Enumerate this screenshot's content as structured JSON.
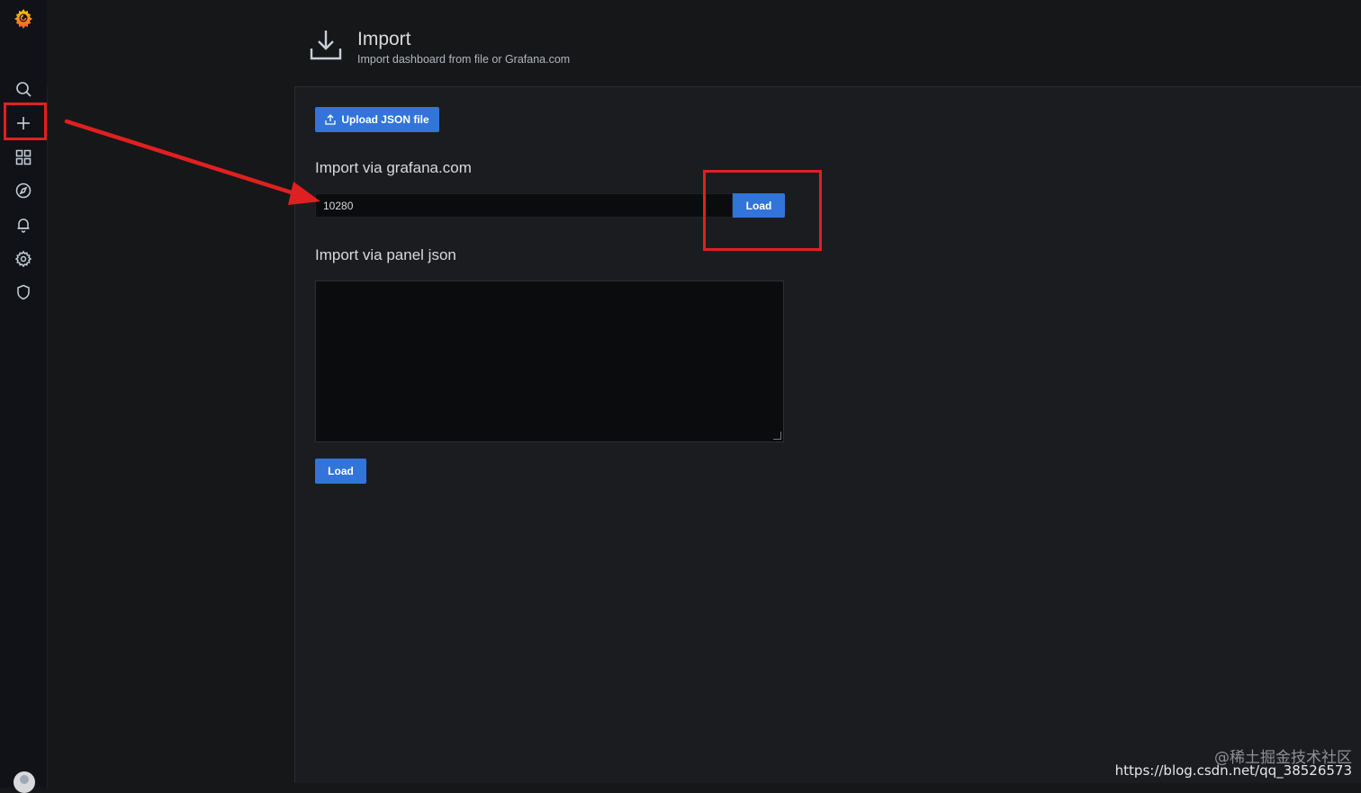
{
  "sidebar": {
    "items": [
      {
        "name": "search-icon"
      },
      {
        "name": "plus-icon"
      },
      {
        "name": "dashboards-icon"
      },
      {
        "name": "compass-icon"
      },
      {
        "name": "bell-icon"
      },
      {
        "name": "gear-icon"
      },
      {
        "name": "shield-icon"
      }
    ],
    "highlighted_item": "plus-icon"
  },
  "header": {
    "title": "Import",
    "subtitle": "Import dashboard from file or Grafana.com",
    "icon": "download-icon"
  },
  "upload": {
    "label": "Upload JSON file",
    "icon": "upload-icon"
  },
  "grafana_import": {
    "title": "Import via grafana.com",
    "input_value": "10280",
    "load_label": "Load"
  },
  "panel_json": {
    "title": "Import via panel json",
    "textarea_value": "",
    "load_label": "Load"
  },
  "watermark": {
    "line1": "@稀土掘金技术社区",
    "line2": "https://blog.csdn.net/qq_38526573"
  },
  "colors": {
    "accent": "#3274d9",
    "annotation": "#e02020",
    "logo": "#f05a28"
  }
}
